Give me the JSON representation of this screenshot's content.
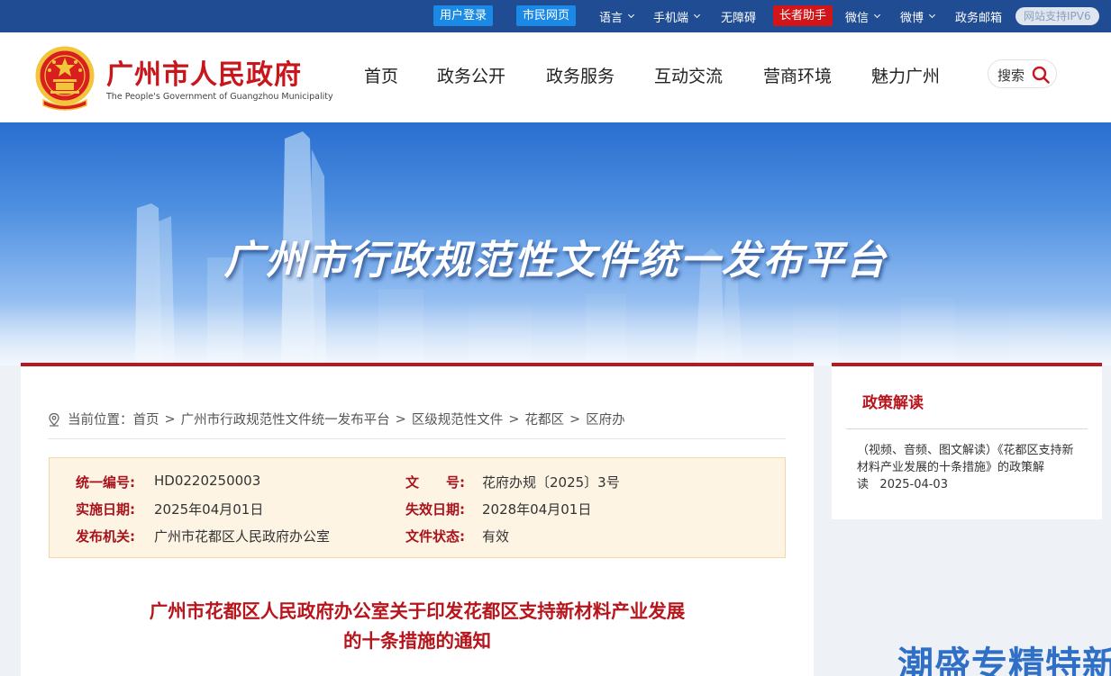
{
  "topbar": {
    "login": "用户登录",
    "citizen_page": "市民网页",
    "language": "语言",
    "mobile": "手机端",
    "accessibility": "无障碍",
    "elder_assistant": "长者助手",
    "wechat": "微信",
    "weibo": "微博",
    "gov_mail": "政务邮箱",
    "ipv6": "网站支持IPV6"
  },
  "header": {
    "title": "广州市人民政府",
    "subtitle": "The People's Government of Guangzhou Municipality",
    "nav": [
      "首页",
      "政务公开",
      "政务服务",
      "互动交流",
      "营商环境",
      "魅力广州"
    ],
    "search_label": "搜索"
  },
  "banner": {
    "title": "广州市行政规范性文件统一发布平台"
  },
  "breadcrumb": {
    "prefix": "当前位置：",
    "items": [
      "首页",
      "广州市行政规范性文件统一发布平台",
      "区级规范性文件",
      "花都区",
      "区府办"
    ],
    "separator": ">"
  },
  "meta": {
    "serial_label": "统一编号:",
    "serial_value": "HD0220250003",
    "docno_label": "文　　号:",
    "docno_value": "花府办规〔2025〕3号",
    "effective_label": "实施日期:",
    "effective_value": "2025年04月01日",
    "expiry_label": "失效日期:",
    "expiry_value": "2028年04月01日",
    "issuer_label": "发布机关:",
    "issuer_value": "广州市花都区人民政府办公室",
    "status_label": "文件状态:",
    "status_value": "有效"
  },
  "document": {
    "title_line1": "广州市花都区人民政府办公室关于印发花都区支持新材料产业发展",
    "title_line2": "的十条措施的通知"
  },
  "side": {
    "title": "政策解读",
    "item_text": "（视频、音频、图文解读）《花都区支持新材料产业发展的十条措施》的政策解读",
    "item_date": "2025-04-03"
  },
  "watermark": "潮盛专精特新",
  "colors": {
    "topbar": "#1f4c93",
    "accent_red": "#b51a1f",
    "chip_blue": "#1a8ae6",
    "meta_bg": "#fdf4e4"
  }
}
